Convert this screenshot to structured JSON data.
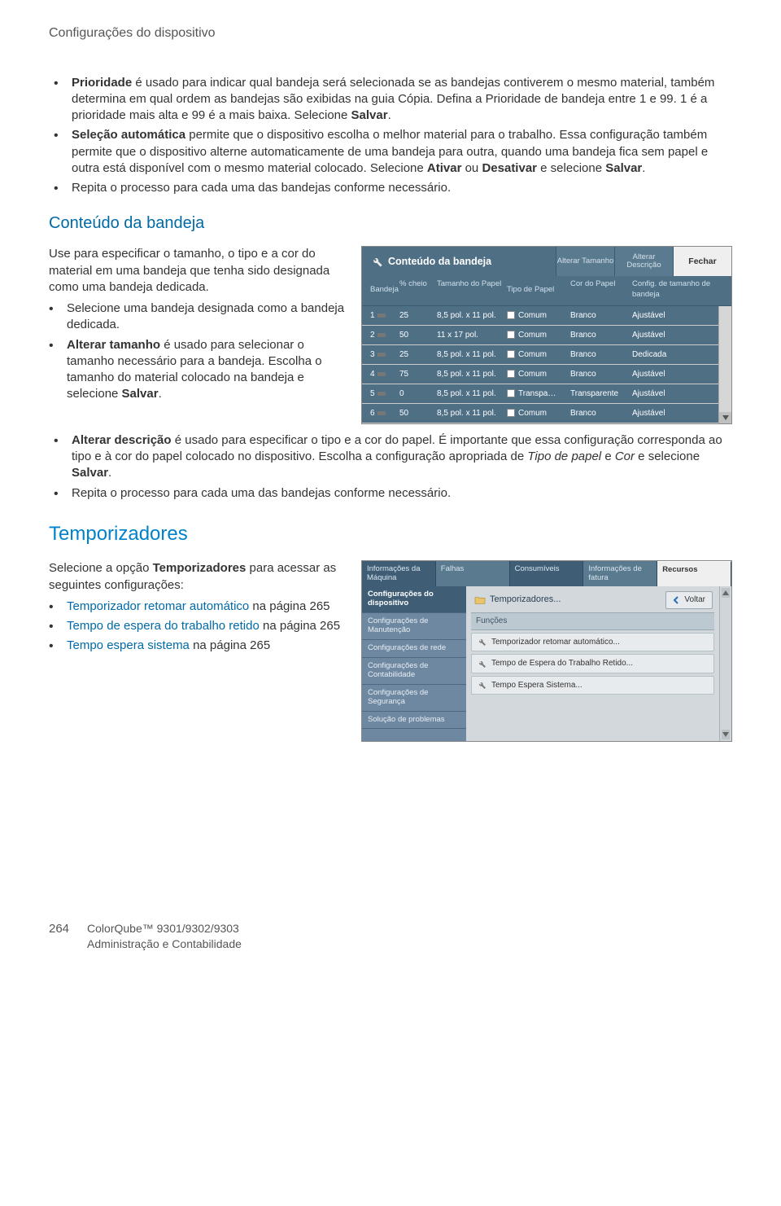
{
  "header": "Configurações do dispositivo",
  "top_bullets": {
    "b1_pre": "Prioridade",
    "b1_text": " é usado para indicar qual bandeja será selecionada se as bandejas contiverem o mesmo material, também determina em qual ordem as bandejas são exibidas na guia Cópia. Defina a Prioridade de bandeja entre 1 e 99. 1 é a prioridade mais alta e 99 é a mais baixa. Selecione ",
    "b1_post": "Salvar",
    "b1_end": ".",
    "b2_pre": "Seleção automática",
    "b2_text": " permite que o dispositivo escolha o melhor material para o trabalho. Essa configuração também permite que o dispositivo alterne automaticamente de uma bandeja para outra, quando uma bandeja fica sem papel e outra está disponível com o mesmo material colocado. Selecione ",
    "b2_a": "Ativar",
    "b2_mid": " ou ",
    "b2_b": "Desativar",
    "b2_mid2": " e selecione ",
    "b2_c": "Salvar",
    "b2_end": ".",
    "b3": "Repita o processo para cada uma das bandejas conforme necessário."
  },
  "subhead1": "Conteúdo da bandeja",
  "para1": "Use para especificar o tamanho, o tipo e a cor do material em uma bandeja que tenha sido designada como uma bandeja dedicada.",
  "list1": {
    "i1": "Selecione uma bandeja designada como a bandeja dedicada.",
    "i2_pre": "Alterar tamanho",
    "i2_text": " é usado para selecionar o tamanho necessário para a bandeja. Escolha o tamanho do material colocado na bandeja e selecione ",
    "i2_post": "Salvar",
    "i2_end": "."
  },
  "cont_bullets": {
    "c1_pre": "Alterar descrição",
    "c1_text": " é usado para especificar o tipo e a cor do papel. É importante que essa configuração corresponda ao tipo e à cor do papel colocado no dispositivo. Escolha a configuração apropriada de ",
    "c1_i1": "Tipo de papel",
    "c1_mid": " e ",
    "c1_i2": "Cor",
    "c1_mid2": " e selecione ",
    "c1_post": "Salvar",
    "c1_end": ".",
    "c2": "Repita o processo para cada uma das bandejas conforme necessário."
  },
  "sechead": "Temporizadores",
  "para2_a": "Selecione a opção ",
  "para2_b": "Temporizadores",
  "para2_c": " para acessar as seguintes configurações:",
  "links": {
    "l1a": "Temporizador retomar automático",
    "l1b": " na página 265",
    "l2a": "Tempo de espera do trabalho retido",
    "l2b": " na página 265",
    "l3a": "Tempo espera sistema",
    "l3b": " na página 265"
  },
  "shot1": {
    "title": "Conteúdo da bandeja",
    "btn1": "Alterar Tamanho",
    "btn2": "Alterar Descrição",
    "btn3": "Fechar",
    "hdr": {
      "b": "Bandeja",
      "p": "% cheio",
      "s": "Tamanho do Papel",
      "t": "Tipo de Papel",
      "c": "Cor do Papel",
      "cfg": "Config. de tamanho de bandeja"
    },
    "rows": [
      {
        "b": "1",
        "p": "25",
        "s": "8,5 pol. x 11 pol.",
        "t": "Comum",
        "c": "Branco",
        "cfg": "Ajustável"
      },
      {
        "b": "2",
        "p": "50",
        "s": "11 x 17 pol.",
        "t": "Comum",
        "c": "Branco",
        "cfg": "Ajustável"
      },
      {
        "b": "3",
        "p": "25",
        "s": "8,5 pol. x 11 pol.",
        "t": "Comum",
        "c": "Branco",
        "cfg": "Dedicada"
      },
      {
        "b": "4",
        "p": "75",
        "s": "8,5 pol. x 11 pol.",
        "t": "Comum",
        "c": "Branco",
        "cfg": "Ajustável"
      },
      {
        "b": "5",
        "p": "0",
        "s": "8,5 pol. x 11 pol.",
        "t": "Transpa…",
        "c": "Transparente",
        "cfg": "Ajustável"
      },
      {
        "b": "6",
        "p": "50",
        "s": "8,5 pol. x 11 pol.",
        "t": "Comum",
        "c": "Branco",
        "cfg": "Ajustável"
      }
    ]
  },
  "shot2": {
    "tabs": [
      "Informações da Máquina",
      "Falhas",
      "Consumíveis",
      "Informações de fatura",
      "Recursos"
    ],
    "side": [
      "Configurações do dispositivo",
      "Configurações de Manutenção",
      "Configurações de rede",
      "Configurações de Contabilidade",
      "Configurações de Segurança",
      "Solução de problemas"
    ],
    "crumb": "Temporizadores...",
    "back": "Voltar",
    "sub": "Funções",
    "items": [
      "Temporizador retomar automático...",
      "Tempo de Espera do Trabalho Retido...",
      "Tempo Espera Sistema..."
    ]
  },
  "footer": {
    "page": "264",
    "line1": "ColorQube™ 9301/9302/9303",
    "line2": "Administração e Contabilidade"
  }
}
